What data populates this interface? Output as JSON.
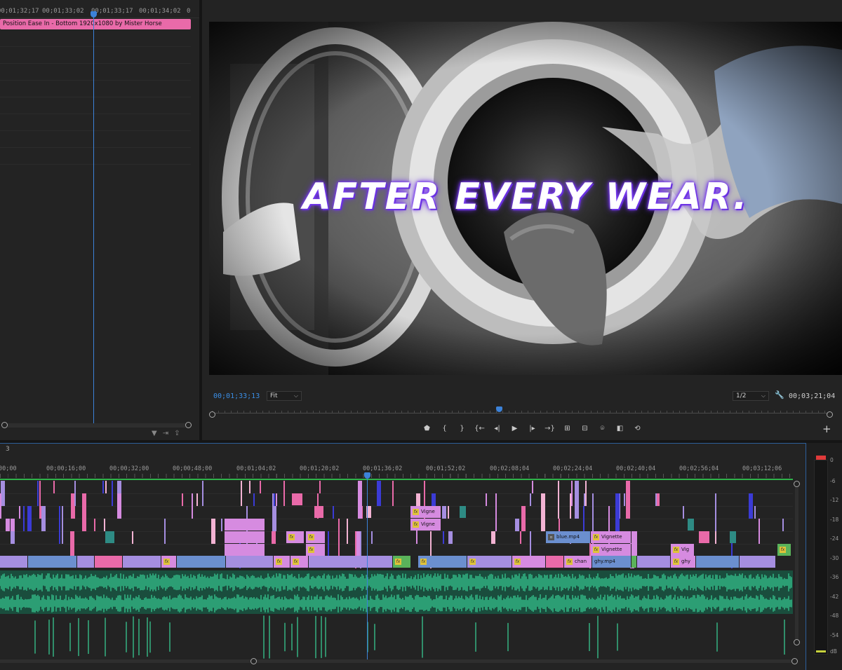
{
  "effect_controls": {
    "ruler_ticks": [
      "00;01;32;17",
      "00;01;33;02",
      "00;01;33;17",
      "00;01;34;02",
      "0"
    ],
    "clip_label": "Position Ease In - Bottom 1920x1080 by Mister Horse"
  },
  "program_monitor": {
    "caption": "AFTER EVERY WEAR.",
    "current_timecode": "00;01;33;13",
    "fit_value": "Fit",
    "resolution_value": "1/2",
    "duration_timecode": "00;03;21;04",
    "transport_icons": [
      "marker-icon",
      "mark-in-icon",
      "mark-out-icon",
      "go-to-in-icon",
      "step-back-icon",
      "play-icon",
      "step-forward-icon",
      "go-to-out-icon",
      "insert-icon",
      "overwrite-icon",
      "export-frame-icon",
      "comparison-view-icon",
      "proxy-toggle-icon"
    ],
    "transport_glyphs": [
      "⬟",
      "{",
      "}",
      "{←",
      "◂|",
      "▶",
      "|▸",
      "→}",
      "⊞",
      "⊟",
      "⌾",
      "◧",
      "⟲"
    ]
  },
  "timeline": {
    "sequence_tab": "3",
    "ruler_ticks": [
      "00;00",
      "00;00;16;00",
      "00;00;32;00",
      "00;00;48;00",
      "00;01;04;02",
      "00;01;20;02",
      "00;01;36;02",
      "00;01;52;02",
      "00;02;08;04",
      "00;02;24;04",
      "00;02;40;04",
      "00;02;56;04",
      "00;03;12;06"
    ],
    "clip_labels": {
      "vigne1": "Vigne",
      "vigne2": "Vigne",
      "blue": "blue.mp4",
      "vignette1": "Vignette",
      "vignette2": "Vignette",
      "vig": "Vig",
      "chan": "chan",
      "ghy_mp4": "ghy.mp4",
      "ghy": "ghy",
      "fx": "fx"
    }
  },
  "audio_meter": {
    "db_labels": [
      "0",
      "-6",
      "-12",
      "-18",
      "-24",
      "-30",
      "-36",
      "-42",
      "-48",
      "-54",
      "dB"
    ]
  },
  "colors": {
    "accent_blue": "#3c82d9",
    "clip_pink": "#e96aa9",
    "clip_violet": "#a58ee0",
    "clip_lavender": "#d68be0",
    "clip_steel": "#6b8fcf",
    "audio_green": "#3ad59a"
  }
}
